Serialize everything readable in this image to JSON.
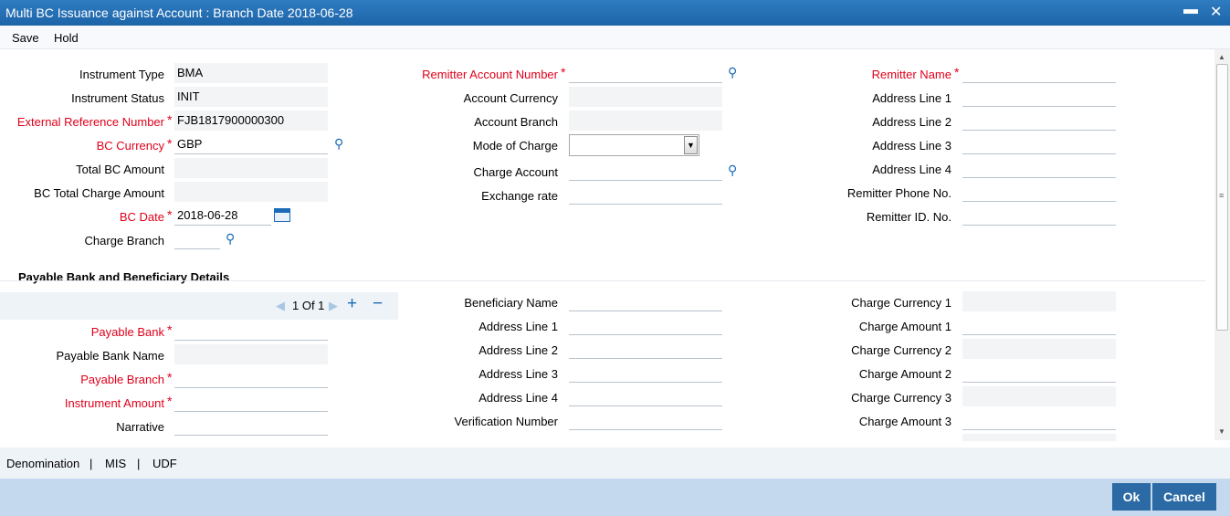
{
  "window": {
    "title": "Multi BC Issuance against Account : Branch Date 2018-06-28",
    "minimize": "▬",
    "close": "✕"
  },
  "menu": {
    "save": "Save",
    "hold": "Hold"
  },
  "col1": {
    "instrument_type": {
      "label": "Instrument Type",
      "value": "BMA"
    },
    "instrument_status": {
      "label": "Instrument Status",
      "value": "INIT"
    },
    "external_ref": {
      "label": "External Reference Number",
      "value": "FJB1817900000300"
    },
    "bc_currency": {
      "label": "BC Currency",
      "value": "GBP"
    },
    "total_bc_amount": {
      "label": "Total BC Amount",
      "value": ""
    },
    "bc_total_charge": {
      "label": "BC Total Charge Amount",
      "value": ""
    },
    "bc_date": {
      "label": "BC Date",
      "value": "2018-06-28"
    },
    "charge_branch": {
      "label": "Charge Branch",
      "value": ""
    }
  },
  "col2": {
    "remitter_account": {
      "label": "Remitter Account Number",
      "value": ""
    },
    "account_currency": {
      "label": "Account Currency",
      "value": ""
    },
    "account_branch": {
      "label": "Account Branch",
      "value": ""
    },
    "mode_of_charge": {
      "label": "Mode of Charge",
      "value": ""
    },
    "charge_account": {
      "label": "Charge Account",
      "value": ""
    },
    "exchange_rate": {
      "label": "Exchange rate",
      "value": ""
    }
  },
  "col3": {
    "remitter_name": {
      "label": "Remitter Name",
      "value": ""
    },
    "address1": {
      "label": "Address Line 1",
      "value": ""
    },
    "address2": {
      "label": "Address Line 2",
      "value": ""
    },
    "address3": {
      "label": "Address Line 3",
      "value": ""
    },
    "address4": {
      "label": "Address Line 4",
      "value": ""
    },
    "phone": {
      "label": "Remitter Phone No.",
      "value": ""
    },
    "remitter_id": {
      "label": "Remitter ID. No.",
      "value": ""
    }
  },
  "payable_section": {
    "title": "Payable Bank and Beneficiary Details",
    "pager": {
      "text": "1 Of 1",
      "add": "+",
      "remove": "−"
    },
    "payable_bank": {
      "label": "Payable Bank",
      "value": ""
    },
    "payable_bank_name": {
      "label": "Payable Bank Name",
      "value": ""
    },
    "payable_branch": {
      "label": "Payable Branch",
      "value": ""
    },
    "instrument_amount": {
      "label": "Instrument Amount",
      "value": ""
    },
    "narrative": {
      "label": "Narrative",
      "value": ""
    },
    "beneficiary_name": {
      "label": "Beneficiary Name",
      "value": ""
    },
    "ben_address1": {
      "label": "Address Line 1",
      "value": ""
    },
    "ben_address2": {
      "label": "Address Line 2",
      "value": ""
    },
    "ben_address3": {
      "label": "Address Line 3",
      "value": ""
    },
    "ben_address4": {
      "label": "Address Line 4",
      "value": ""
    },
    "verification": {
      "label": "Verification Number",
      "value": ""
    },
    "charge_currency1": {
      "label": "Charge Currency 1",
      "value": ""
    },
    "charge_amount1": {
      "label": "Charge Amount 1",
      "value": ""
    },
    "charge_currency2": {
      "label": "Charge Currency 2",
      "value": ""
    },
    "charge_amount2": {
      "label": "Charge Amount 2",
      "value": ""
    },
    "charge_currency3": {
      "label": "Charge Currency 3",
      "value": ""
    },
    "charge_amount3": {
      "label": "Charge Amount 3",
      "value": ""
    }
  },
  "links": {
    "denomination": "Denomination",
    "mis": "MIS",
    "udf": "UDF",
    "sep": "|"
  },
  "buttons": {
    "ok": "Ok",
    "cancel": "Cancel"
  },
  "required_marker": "*",
  "colors": {
    "title_bar": "#1d64a8",
    "required": "#e0001a",
    "button": "#2b6aa4",
    "footer": "#c4d9ee"
  }
}
